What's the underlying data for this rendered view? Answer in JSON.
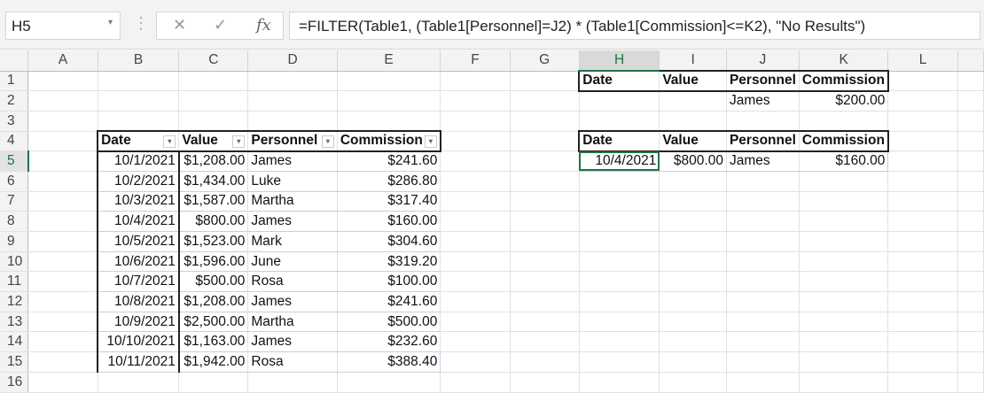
{
  "formula_bar": {
    "name_box": "H5",
    "cancel_icon": "✕",
    "enter_icon": "✓",
    "fx_label": "fx",
    "formula": "=FILTER(Table1, (Table1[Personnel]=J2) * (Table1[Commission]<=K2), \"No Results\")"
  },
  "columns": [
    "A",
    "B",
    "C",
    "D",
    "E",
    "F",
    "G",
    "H",
    "I",
    "J",
    "K",
    "L"
  ],
  "rows": [
    "1",
    "2",
    "3",
    "4",
    "5",
    "6",
    "7",
    "8",
    "9",
    "10",
    "11",
    "12",
    "13",
    "14",
    "15",
    "16"
  ],
  "table1": {
    "headers": [
      "Date",
      "Value",
      "Personnel",
      "Commission"
    ],
    "rows": [
      [
        "10/1/2021",
        "$1,208.00",
        "James",
        "$241.60"
      ],
      [
        "10/2/2021",
        "$1,434.00",
        "Luke",
        "$286.80"
      ],
      [
        "10/3/2021",
        "$1,587.00",
        "Martha",
        "$317.40"
      ],
      [
        "10/4/2021",
        "$800.00",
        "James",
        "$160.00"
      ],
      [
        "10/5/2021",
        "$1,523.00",
        "Mark",
        "$304.60"
      ],
      [
        "10/6/2021",
        "$1,596.00",
        "June",
        "$319.20"
      ],
      [
        "10/7/2021",
        "$500.00",
        "Rosa",
        "$100.00"
      ],
      [
        "10/8/2021",
        "$1,208.00",
        "James",
        "$241.60"
      ],
      [
        "10/9/2021",
        "$2,500.00",
        "Martha",
        "$500.00"
      ],
      [
        "10/10/2021",
        "$1,163.00",
        "James",
        "$232.60"
      ],
      [
        "10/11/2021",
        "$1,942.00",
        "Rosa",
        "$388.40"
      ]
    ]
  },
  "criteria": {
    "headers": [
      "Date",
      "Value",
      "Personnel",
      "Commission"
    ],
    "values": [
      "",
      "",
      "James",
      "$200.00"
    ]
  },
  "results": {
    "headers": [
      "Date",
      "Value",
      "Personnel",
      "Commission"
    ],
    "rows": [
      [
        "10/4/2021",
        "$800.00",
        "James",
        "$160.00"
      ]
    ]
  },
  "selected_cell": "H5",
  "colors": {
    "accent": "#217346"
  }
}
